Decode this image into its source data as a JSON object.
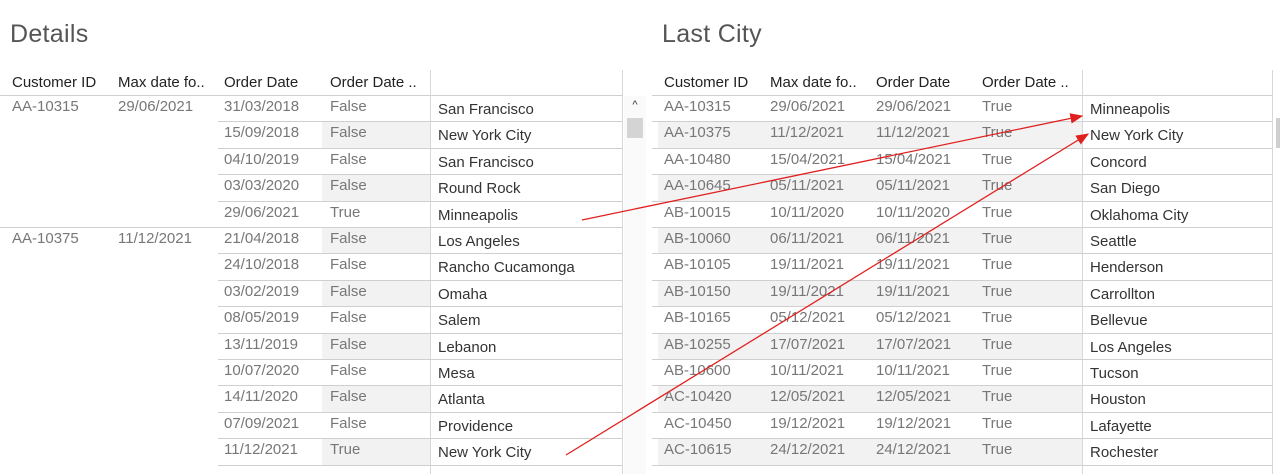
{
  "details": {
    "title": "Details",
    "headers": [
      "Customer ID",
      "Max date fo..",
      "Order Date",
      "Order Date .."
    ],
    "rows": [
      {
        "cust": "AA-10315",
        "max": "29/06/2021",
        "date": "31/03/2018",
        "flag": "False",
        "city": "San Francisco"
      },
      {
        "cust": "",
        "max": "",
        "date": "15/09/2018",
        "flag": "False",
        "city": "New York City"
      },
      {
        "cust": "",
        "max": "",
        "date": "04/10/2019",
        "flag": "False",
        "city": "San Francisco"
      },
      {
        "cust": "",
        "max": "",
        "date": "03/03/2020",
        "flag": "False",
        "city": "Round Rock"
      },
      {
        "cust": "",
        "max": "",
        "date": "29/06/2021",
        "flag": "True",
        "city": "Minneapolis"
      },
      {
        "cust": "AA-10375",
        "max": "11/12/2021",
        "date": "21/04/2018",
        "flag": "False",
        "city": "Los Angeles"
      },
      {
        "cust": "",
        "max": "",
        "date": "24/10/2018",
        "flag": "False",
        "city": "Rancho Cucamonga"
      },
      {
        "cust": "",
        "max": "",
        "date": "03/02/2019",
        "flag": "False",
        "city": "Omaha"
      },
      {
        "cust": "",
        "max": "",
        "date": "08/05/2019",
        "flag": "False",
        "city": "Salem"
      },
      {
        "cust": "",
        "max": "",
        "date": "13/11/2019",
        "flag": "False",
        "city": "Lebanon"
      },
      {
        "cust": "",
        "max": "",
        "date": "10/07/2020",
        "flag": "False",
        "city": "Mesa"
      },
      {
        "cust": "",
        "max": "",
        "date": "14/11/2020",
        "flag": "False",
        "city": "Atlanta"
      },
      {
        "cust": "",
        "max": "",
        "date": "07/09/2021",
        "flag": "False",
        "city": "Providence"
      },
      {
        "cust": "",
        "max": "",
        "date": "11/12/2021",
        "flag": "True",
        "city": "New York City"
      }
    ]
  },
  "lastcity": {
    "title": "Last City",
    "headers": [
      "Customer ID",
      "Max date fo..",
      "Order Date",
      "Order Date .."
    ],
    "rows": [
      {
        "cust": "AA-10315",
        "max": "29/06/2021",
        "date": "29/06/2021",
        "flag": "True",
        "city": "Minneapolis"
      },
      {
        "cust": "AA-10375",
        "max": "11/12/2021",
        "date": "11/12/2021",
        "flag": "True",
        "city": "New York City"
      },
      {
        "cust": "AA-10480",
        "max": "15/04/2021",
        "date": "15/04/2021",
        "flag": "True",
        "city": "Concord"
      },
      {
        "cust": "AA-10645",
        "max": "05/11/2021",
        "date": "05/11/2021",
        "flag": "True",
        "city": "San Diego"
      },
      {
        "cust": "AB-10015",
        "max": "10/11/2020",
        "date": "10/11/2020",
        "flag": "True",
        "city": "Oklahoma City"
      },
      {
        "cust": "AB-10060",
        "max": "06/11/2021",
        "date": "06/11/2021",
        "flag": "True",
        "city": "Seattle"
      },
      {
        "cust": "AB-10105",
        "max": "19/11/2021",
        "date": "19/11/2021",
        "flag": "True",
        "city": "Henderson"
      },
      {
        "cust": "AB-10150",
        "max": "19/11/2021",
        "date": "19/11/2021",
        "flag": "True",
        "city": "Carrollton"
      },
      {
        "cust": "AB-10165",
        "max": "05/12/2021",
        "date": "05/12/2021",
        "flag": "True",
        "city": "Bellevue"
      },
      {
        "cust": "AB-10255",
        "max": "17/07/2021",
        "date": "17/07/2021",
        "flag": "True",
        "city": "Los Angeles"
      },
      {
        "cust": "AB-10600",
        "max": "10/11/2021",
        "date": "10/11/2021",
        "flag": "True",
        "city": "Tucson"
      },
      {
        "cust": "AC-10420",
        "max": "12/05/2021",
        "date": "12/05/2021",
        "flag": "True",
        "city": "Houston"
      },
      {
        "cust": "AC-10450",
        "max": "19/12/2021",
        "date": "19/12/2021",
        "flag": "True",
        "city": "Lafayette"
      },
      {
        "cust": "AC-10615",
        "max": "24/12/2021",
        "date": "24/12/2021",
        "flag": "True",
        "city": "Rochester"
      }
    ]
  },
  "scrollbar": {
    "up_icon": "chevron-up-icon",
    "up_glyph": "^"
  },
  "arrows": {
    "color": "#e0201f"
  }
}
